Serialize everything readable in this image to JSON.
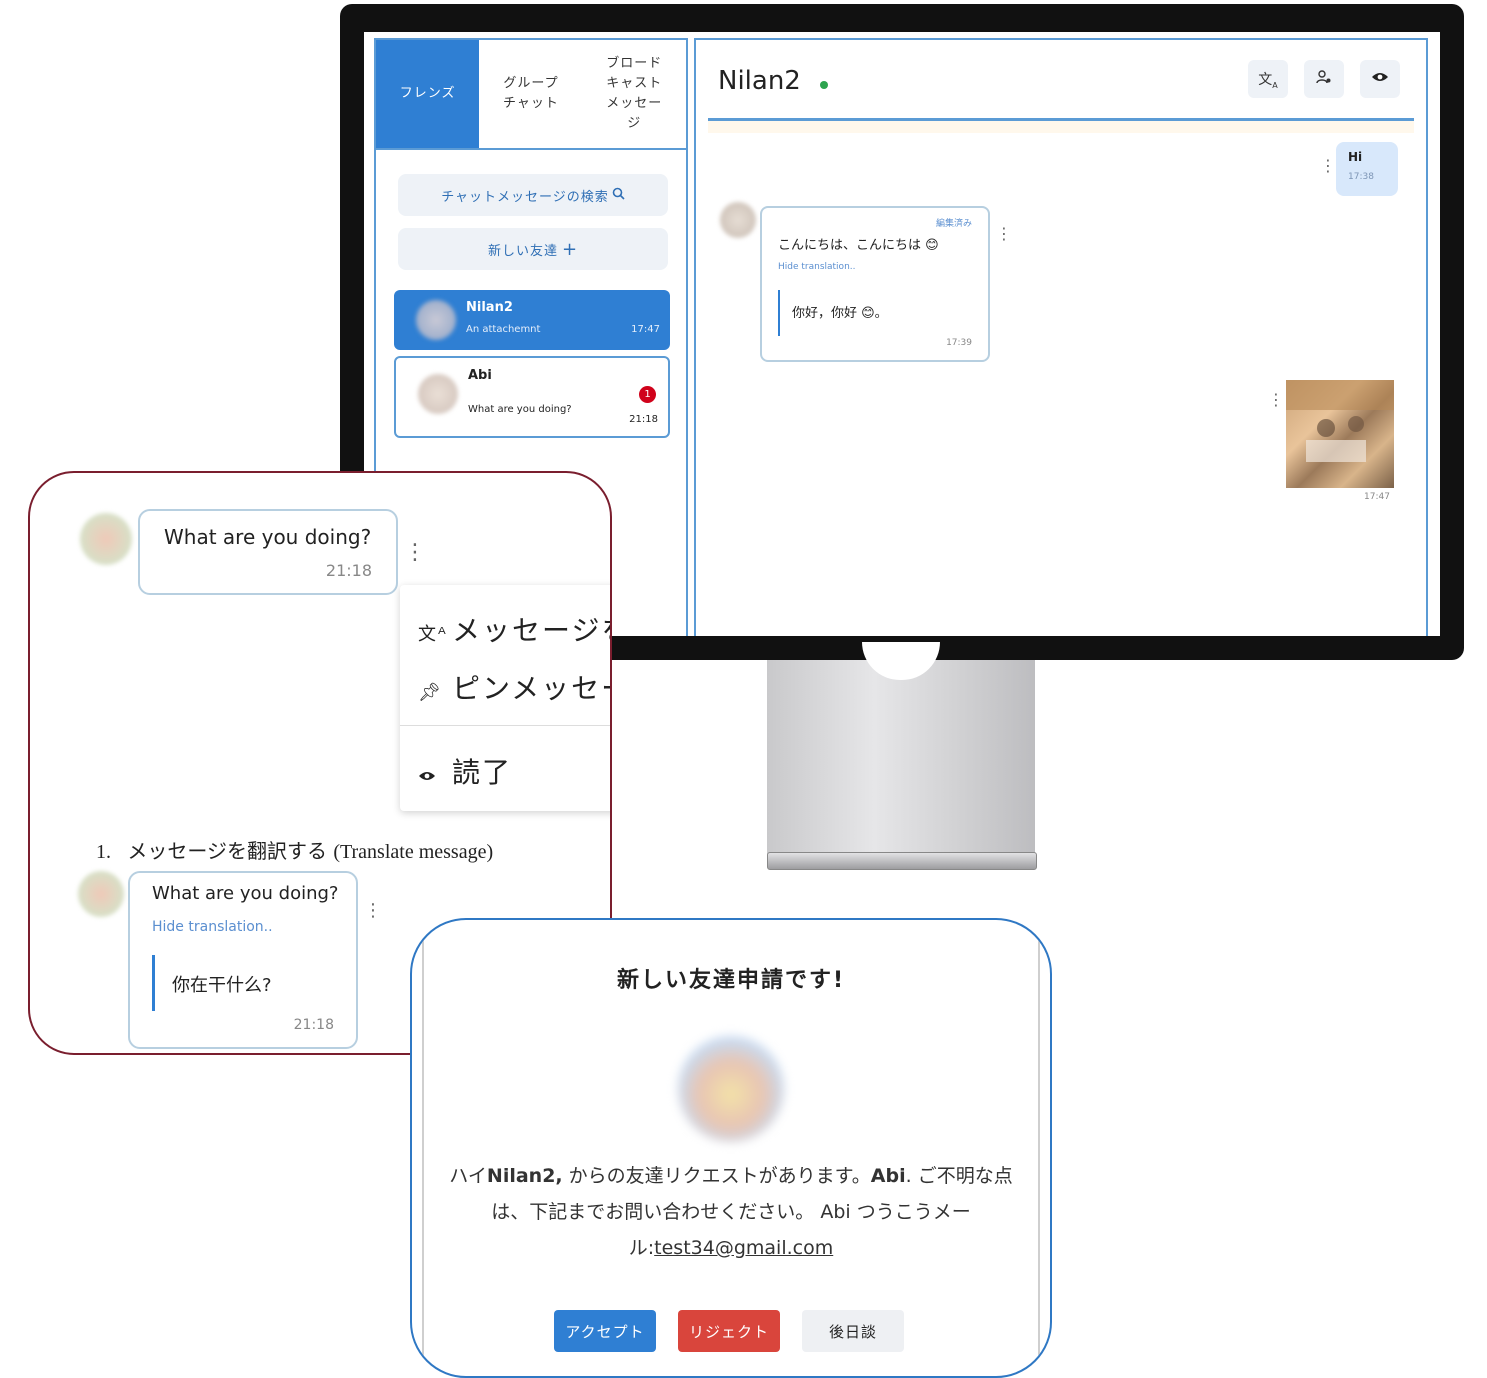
{
  "sidebar": {
    "tabs": [
      {
        "label": "フレンズ"
      },
      {
        "label": "グループチャット"
      },
      {
        "label": "ブロードキャストメッセージ"
      }
    ],
    "search_button": "チャットメッセージの検索",
    "new_friend_button": "新しい友達",
    "contacts": [
      {
        "name": "Nilan2",
        "preview": "An attachemnt",
        "time": "17:47"
      },
      {
        "name": "Abi",
        "preview": "What are you doing?",
        "time": "21:18",
        "badge": "1"
      }
    ]
  },
  "chat": {
    "title": "Nilan2",
    "header_icons": [
      "translate-icon",
      "user-settings-icon",
      "eye-icon"
    ],
    "messages": [
      {
        "text": "Hi",
        "time": "17:38"
      },
      {
        "edited": "編集済み",
        "text": "こんにちは、こんにちは 😊",
        "hide_translation": "Hide translation..",
        "translation": "你好，你好 😊。",
        "time": "17:39"
      },
      {
        "time": "17:47"
      }
    ]
  },
  "popup_menu": {
    "message": {
      "text": "What are you doing?",
      "time": "21:18"
    },
    "items": [
      {
        "label": "メッセージを",
        "icon": "translate-icon"
      },
      {
        "label": "ピンメッセー",
        "icon": "pin-icon"
      },
      {
        "label": "読了",
        "icon": "eye-icon"
      }
    ],
    "caption_num": "1.",
    "caption_jp": "メッセージを翻訳する",
    "caption_en": "(Translate message)",
    "translated_message": {
      "text": "What are you doing?",
      "hide_translation": "Hide translation..",
      "translation": "你在干什么?",
      "time": "21:18"
    }
  },
  "friend_request": {
    "title": "新しい友達申請です!",
    "body_1": "ハイ",
    "body_name1": "Nilan2,",
    "body_2": " からの友達リクエストがあります。",
    "body_name2": "Abi",
    "body_3": ". ご不明な点は、下記までお問い合わせください。 Abi つうこうメール:",
    "email": "test34@gmail.com",
    "accept": "アクセプト",
    "reject": "リジェクト",
    "later": "後日談"
  },
  "colors": {
    "primary": "#2f7fd3",
    "reject": "#d9453c",
    "popup1_border": "#7a1e2e",
    "popup2_border": "#2f78c4",
    "badge": "#d0021b"
  }
}
